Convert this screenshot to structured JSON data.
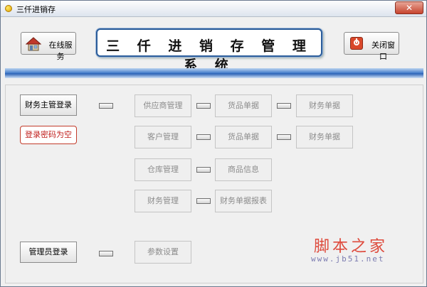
{
  "window": {
    "title": "三仟进销存"
  },
  "header": {
    "online_service_label": "在线服务",
    "system_title": "三 仟 进 销 存 管 理 系 统",
    "close_window_label": "关闭窗口"
  },
  "login": {
    "finance_supervisor_label": "财务主管登录",
    "password_empty_label": "登录密码为空",
    "admin_label": "管理员登录"
  },
  "modules": {
    "supplier_management": "供应商管理",
    "supplier_goods_doc": "货品单据",
    "supplier_finance_doc": "财务单据",
    "customer_management": "客户管理",
    "customer_goods_doc": "货品单据",
    "customer_finance_doc": "财务单据",
    "warehouse_management": "仓库管理",
    "product_info": "商品信息",
    "finance_management": "财务管理",
    "finance_report": "财务单据报表",
    "parameter_settings": "参数设置"
  },
  "watermark": {
    "text": "脚本之家",
    "url": "www.jb51.net"
  },
  "icons": [
    "app-icon",
    "close-icon",
    "house-icon",
    "power-icon"
  ],
  "colors": {
    "accent_blue": "#2d64b7",
    "warning_red": "#c0201e",
    "watermark_red": "#de4a3c"
  }
}
